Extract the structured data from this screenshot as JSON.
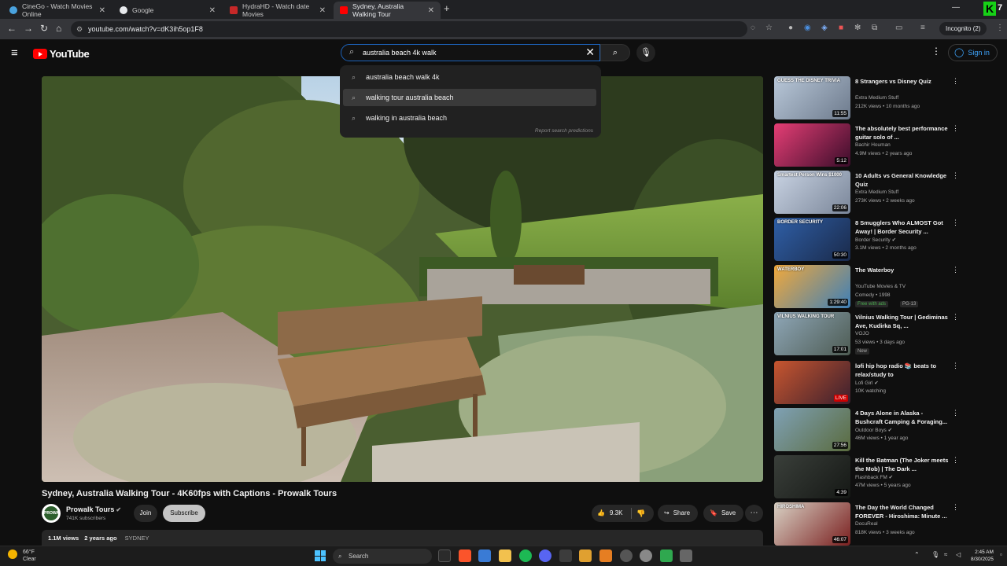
{
  "browser": {
    "tabs": [
      {
        "title": "CineGo - Watch Movies Online",
        "color": "#4aa3df"
      },
      {
        "title": "Google",
        "color": "#e8eaed"
      },
      {
        "title": "HydraHD - Watch date Movies",
        "color": "#c62828"
      },
      {
        "title": "Sydney, Australia Walking Tour",
        "color": "#ff0000"
      }
    ],
    "url": "youtube.com/watch?v=dK3ih5op1F8",
    "incognito_label": "Incognito (2)",
    "k_badge": "K",
    "k_badge_num": "7"
  },
  "youtube": {
    "logo_text": "YouTube",
    "search_query": "australia beach 4k walk",
    "sign_in_label": "Sign in",
    "suggestions": [
      "australia beach walk 4k",
      "walking tour australia beach",
      "walking in australia beach"
    ],
    "report_label": "Report search predictions"
  },
  "video": {
    "title": "Sydney, Australia Walking Tour - 4K60fps with Captions - Prowalk Tours",
    "channel": "Prowalk Tours",
    "channel_avatar_text": "PROWALK TOURS",
    "subscribers": "741K subscribers",
    "join_label": "Join",
    "subscribe_label": "Subscribe",
    "likes": "9.3K",
    "share_label": "Share",
    "save_label": "Save",
    "views": "1.1M views",
    "age": "2 years ago",
    "tag": "SYDNEY"
  },
  "recommendations": [
    {
      "title": "8 Strangers vs Disney Quiz",
      "channel": "Extra Medium Stuff",
      "meta": "212K views • 10 months ago",
      "duration": "11:55",
      "verified": false,
      "thumb": [
        "#b9c8d9",
        "#6d7a8c"
      ],
      "thumb_text": "GUESS THE DISNEY TRIVIA"
    },
    {
      "title": "The absolutely best performance guitar solo of ...",
      "channel": "Bachir Houman",
      "meta": "4.9M views • 2 years ago",
      "duration": "5:12",
      "verified": false,
      "thumb": [
        "#e53e75",
        "#3a0d2a"
      ],
      "thumb_text": ""
    },
    {
      "title": "10 Adults vs General Knowledge Quiz",
      "channel": "Extra Medium Stuff",
      "meta": "273K views • 2 weeks ago",
      "duration": "22:06",
      "verified": false,
      "thumb": [
        "#c9d3e3",
        "#7a8699"
      ],
      "thumb_text": "Smartest Person Wins $1000"
    },
    {
      "title": "8 Smugglers Who ALMOST Got Away! | Border Security ...",
      "channel": "Border Security",
      "meta": "3.1M views • 2 months ago",
      "duration": "50:30",
      "verified": true,
      "thumb": [
        "#2f5fa7",
        "#1a2a4a"
      ],
      "thumb_text": "BORDER SECURITY"
    },
    {
      "title": "The Waterboy",
      "channel": "YouTube Movies & TV",
      "meta": "Comedy • 1998",
      "duration": "1:29:40",
      "verified": false,
      "badge": "Free with ads",
      "badge2": "PG-13",
      "thumb": [
        "#f2a93b",
        "#3d7fb8"
      ],
      "thumb_text": "WATERBOY"
    },
    {
      "title": "Vilnius Walking Tour | Gediminas Ave, Kudirka Sq, ...",
      "channel": "VOJO",
      "meta": "53 views • 3 days ago",
      "duration": "17:01",
      "verified": false,
      "badge": "New",
      "thumb": [
        "#8fa7b8",
        "#4d5b52"
      ],
      "thumb_text": "VILNIUS WALKING TOUR"
    },
    {
      "title": "lofi hip hop radio 📚 beats to relax/study to",
      "channel": "Lofi Girl",
      "meta": "10K watching",
      "duration": "LIVE",
      "live": true,
      "verified": true,
      "thumb": [
        "#c8562f",
        "#3a1f2e"
      ],
      "thumb_text": ""
    },
    {
      "title": "4 Days Alone in Alaska - Bushcraft Camping & Foraging...",
      "channel": "Outdoor Boys",
      "meta": "46M views • 1 year ago",
      "duration": "27:56",
      "verified": true,
      "thumb": [
        "#7fa1b5",
        "#5a6b3e"
      ],
      "thumb_text": ""
    },
    {
      "title": "Kill the Batman (The Joker meets the Mob) | The Dark ...",
      "channel": "Flashback FM",
      "meta": "47M views • 5 years ago",
      "duration": "4:39",
      "verified": true,
      "thumb": [
        "#3a3f3a",
        "#151815"
      ],
      "thumb_text": ""
    },
    {
      "title": "The Day the World Changed FOREVER - Hiroshima: Minute ...",
      "channel": "DocuReal",
      "meta": "818K views • 3 weeks ago",
      "duration": "46:07",
      "verified": false,
      "thumb": [
        "#d9d2c5",
        "#7a1f1f"
      ],
      "thumb_text": "HIROSHIMA"
    }
  ],
  "taskbar": {
    "temp": "66°F",
    "condition": "Clear",
    "search_label": "Search",
    "time": "2:45 AM",
    "date": "8/30/2025"
  },
  "colors": {
    "accent": "#3ea6ff",
    "brand": "#ff0000",
    "search_border": "#1c62b9"
  }
}
